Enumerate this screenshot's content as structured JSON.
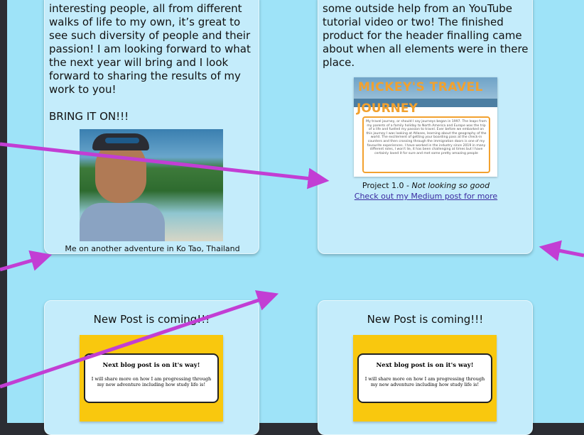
{
  "card1": {
    "paragraphs": [
      "interesting people, all from different walks of life to my own, it’s great to see such diversity of people and their passion! I am looking forward to what the next year will bring and I look forward to sharing the results of my work to you!",
      "BRING IT ON!!!"
    ],
    "caption": "Me on another adventure in Ko Tao, Thailand"
  },
  "card2": {
    "text": "some outside help from an YouTube tutorial video or two! The finished product for the header finalling came about when all elements were in there place.",
    "image_title_line1": "MICKEY'S TRAVEL",
    "image_title_line2": "JOURNEY",
    "image_body": "My travel journey, or should I say journeys began in 1997. The leaps from my parents of a family holiday to North America and Europe was the trip of a life and fuelled my passion to travel. Ever before we embarked on this journey I was looking at Atlases, learning about the geography of the world. The excitement of getting your boarding pass at the check-in counters and then crossing through the immigration doors is one of my favourite experiences. I have worked in the industry since 2019 in many different roles, I won't lie, it has been challenging at times but I have certainly loved it for sure and met some pretty amazing people",
    "caption_prefix": "Project 1.0 - ",
    "caption_italic": "Not looking so good",
    "link": "Check out my Medium post for more"
  },
  "card3": {
    "title": "New Post is coming!!!",
    "image_title": "Next blog post is on it's way!",
    "image_body": "I will share more on how I am progressing through my new adventure including how study life is!"
  },
  "card4": {
    "title": "New Post is coming!!!",
    "image_title": "Next blog post is on it's way!",
    "image_body": "I will share more on how I am progressing through my new adventure including how study life is!"
  },
  "colors": {
    "page_background": "#9ee3f8",
    "card_background": "#c4ecfb",
    "arrow": "#c23ed4",
    "post_image": "#f9c80e",
    "link": "#3a2aa0"
  }
}
